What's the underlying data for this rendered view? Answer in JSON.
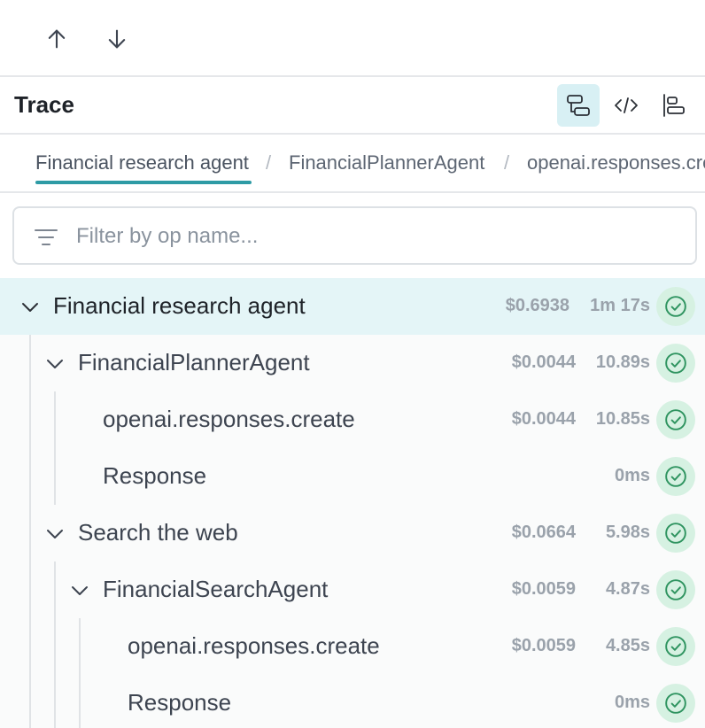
{
  "nav": {
    "up_icon": "arrow-up-icon",
    "down_icon": "arrow-down-icon"
  },
  "header": {
    "title": "Trace",
    "views": [
      {
        "icon": "tree-view-icon",
        "active": true
      },
      {
        "icon": "code-view-icon",
        "active": false
      },
      {
        "icon": "timeline-view-icon",
        "active": false
      }
    ]
  },
  "breadcrumb": {
    "items": [
      "Financial research agent",
      "FinancialPlannerAgent",
      "openai.responses.create"
    ],
    "separator": "/"
  },
  "filter": {
    "placeholder": "Filter by op name...",
    "value": "",
    "icon": "filter-lines-icon"
  },
  "tree": {
    "rows": [
      {
        "label": "Financial research agent",
        "cost": "$0.6938",
        "duration": "1m 17s",
        "expanded": true,
        "selected": true,
        "status": "success"
      },
      {
        "label": "FinancialPlannerAgent",
        "cost": "$0.0044",
        "duration": "10.89s",
        "expanded": true,
        "status": "success"
      },
      {
        "label": "openai.responses.create",
        "cost": "$0.0044",
        "duration": "10.85s",
        "status": "success"
      },
      {
        "label": "Response",
        "cost": "",
        "duration": "0ms",
        "status": "success"
      },
      {
        "label": "Search the web",
        "cost": "$0.0664",
        "duration": "5.98s",
        "expanded": true,
        "status": "success"
      },
      {
        "label": "FinancialSearchAgent",
        "cost": "$0.0059",
        "duration": "4.87s",
        "expanded": true,
        "status": "success"
      },
      {
        "label": "openai.responses.create",
        "cost": "$0.0059",
        "duration": "4.85s",
        "status": "success"
      },
      {
        "label": "Response",
        "cost": "",
        "duration": "0ms",
        "status": "success"
      }
    ]
  },
  "colors": {
    "accent": "#2e9ba5",
    "selected_row": "#e4f5f7",
    "status_bg": "#d6f1e2",
    "status_fg": "#2f9460"
  }
}
